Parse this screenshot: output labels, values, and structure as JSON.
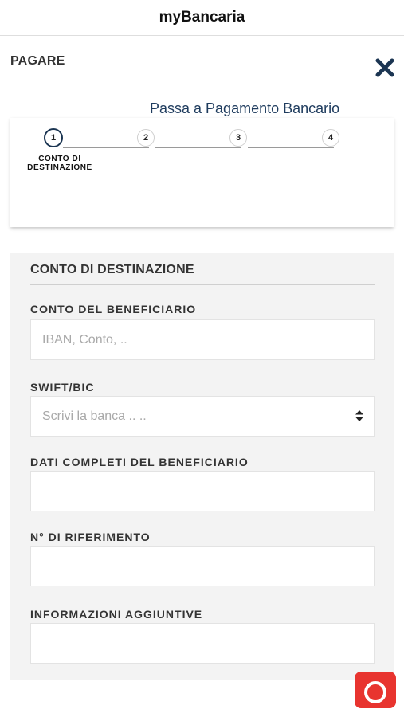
{
  "header": {
    "title": "myBancaria"
  },
  "page": {
    "section_label": "PAGARE",
    "switch_link": "Passa a Pagamento Bancario"
  },
  "stepper": {
    "active_step": 1,
    "steps": [
      {
        "number": "1",
        "caption": "CONTO DI DESTINAZIONE"
      },
      {
        "number": "2"
      },
      {
        "number": "3"
      },
      {
        "number": "4"
      }
    ]
  },
  "form": {
    "title": "CONTO DI DESTINAZIONE",
    "fields": [
      {
        "label": "CONTO DEL BENEFICIARIO",
        "placeholder": "IBAN, Conto, ..",
        "value": ""
      },
      {
        "label": "SWIFT/BIC",
        "placeholder": "Scrivi la banca .. ..",
        "value": ""
      },
      {
        "label": "DATI COMPLETI DEL BENEFICIARIO",
        "placeholder": "",
        "value": ""
      },
      {
        "label": "N° DI RIFERIMENTO",
        "placeholder": "",
        "value": ""
      },
      {
        "label": "INFORMAZIONI AGGIUNTIVE",
        "placeholder": "",
        "value": ""
      }
    ]
  },
  "icons": {
    "close": "close-icon",
    "select": "sort-arrows-icon",
    "camera": "camera-icon"
  },
  "colors": {
    "accent": "#1b3552",
    "link": "#1f3c5e",
    "camera_button": "#e8342f",
    "panel": "#f3f3f3"
  }
}
